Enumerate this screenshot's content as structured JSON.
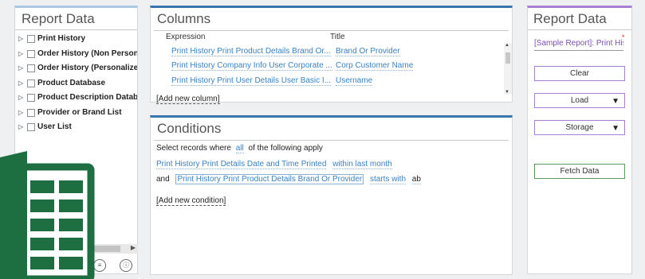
{
  "left_panel": {
    "title": "Report Data",
    "items": [
      {
        "label": "Print History"
      },
      {
        "label": "Order History (Non Personalized)"
      },
      {
        "label": "Order History (Personalized)"
      },
      {
        "label": "Product Database"
      },
      {
        "label": "Product Description Database"
      },
      {
        "label": "Provider or Brand List"
      },
      {
        "label": "User List"
      }
    ],
    "icons": [
      "arrow-icon",
      "list-icon",
      "info-icon"
    ]
  },
  "columns": {
    "title": "Columns",
    "header_expression": "Expression",
    "header_title": "Title",
    "rows": [
      {
        "expression": "Print History Print Product Details Brand Or...",
        "title": "Brand Or Provider"
      },
      {
        "expression": "Print History Company Info User Corporate ...",
        "title": "Corp Customer Name"
      },
      {
        "expression": "Print History Print User Details User Basic I...",
        "title": "Username"
      }
    ],
    "add_label": "[Add new column]"
  },
  "conditions": {
    "title": "Conditions",
    "intro_prefix": "Select records where",
    "intro_quantifier": "all",
    "intro_suffix": "of the following apply",
    "rows": [
      {
        "connector": "",
        "field": "Print History Print Details Date and Time Printed",
        "operator": "within last month",
        "value": ""
      },
      {
        "connector": "and",
        "field": "Print History Print Product Details Brand Or Provider",
        "operator": "starts with",
        "value": "ab"
      }
    ],
    "add_label": "[Add new condition]"
  },
  "right_panel": {
    "title": "Report Data",
    "sample_report": "[Sample Report]: Print History",
    "required_mark": "*",
    "clear_label": "Clear",
    "load_label": "Load",
    "storage_label": "Storage",
    "fetch_label": "Fetch Data"
  },
  "colors": {
    "accent_blue": "#3a74ad",
    "link_blue": "#3a82c4",
    "accent_purple": "#a97fd4",
    "fetch_green": "#5a9a5a",
    "excel_green": "#1d6f42"
  }
}
